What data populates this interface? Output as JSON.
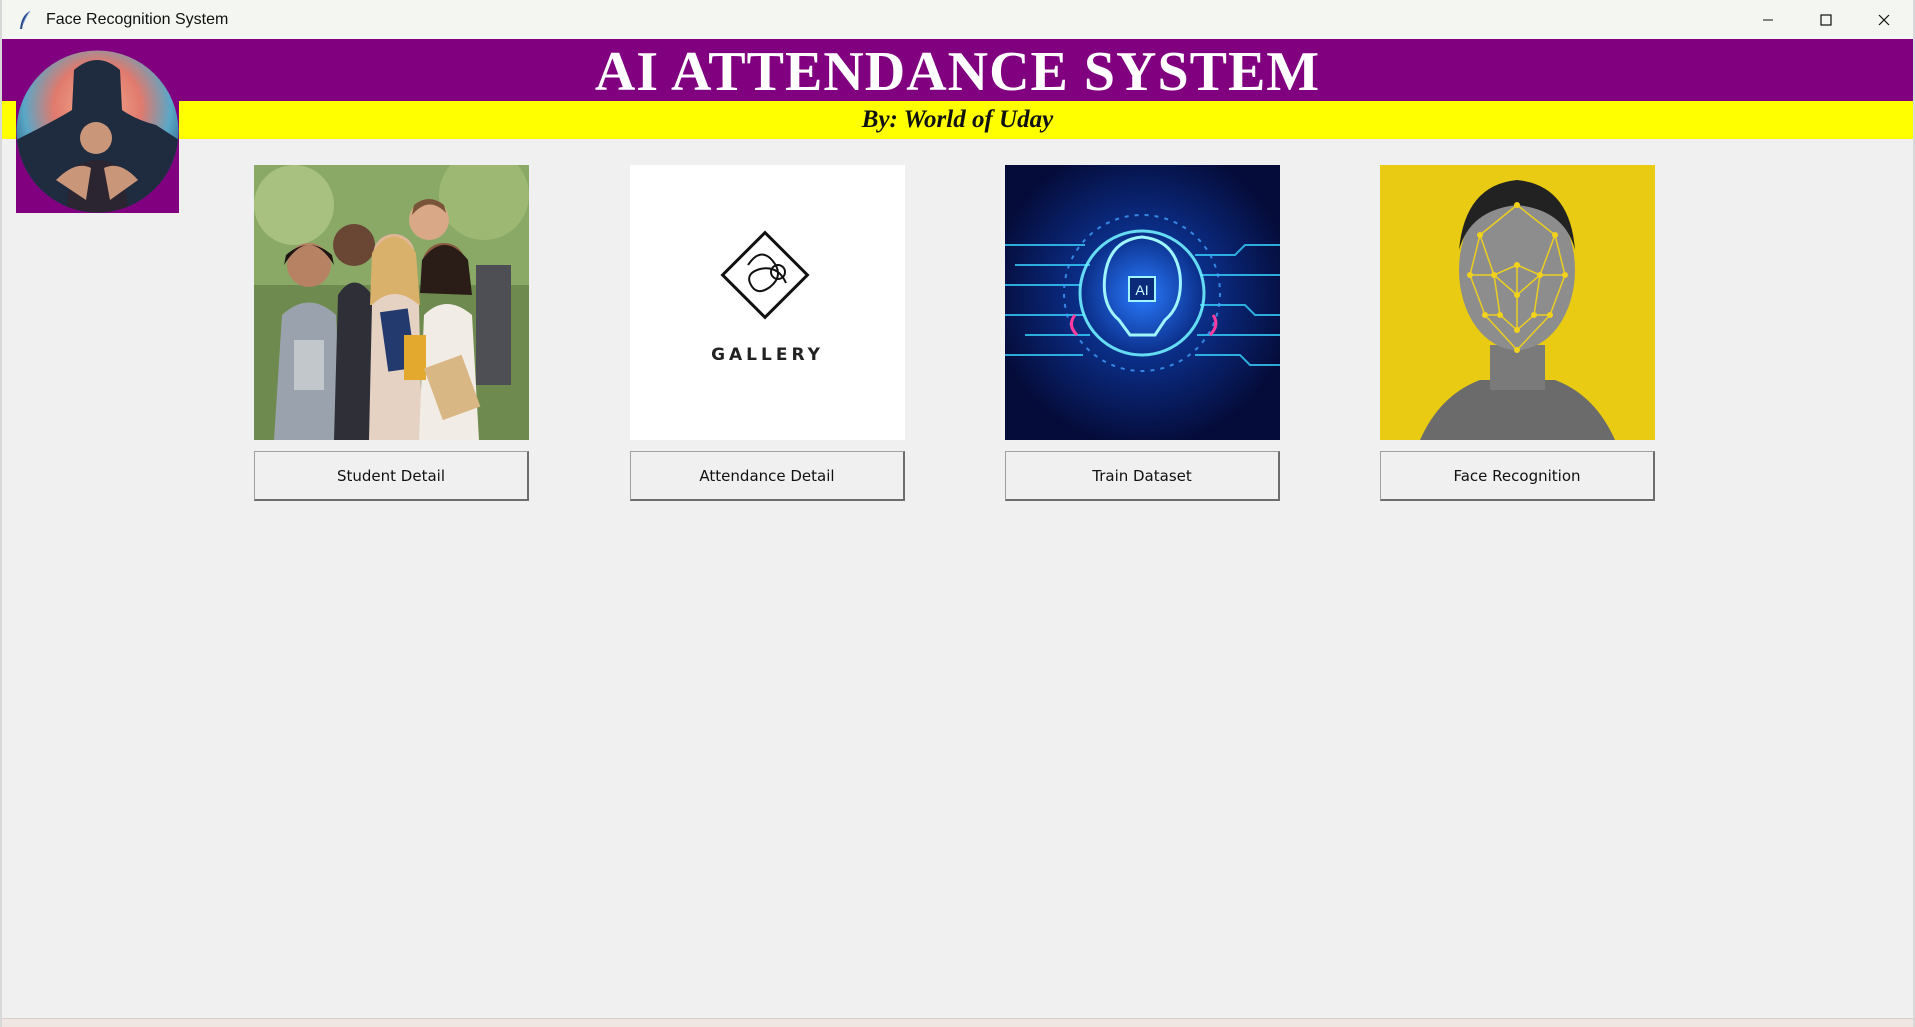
{
  "window": {
    "title": "Face Recognition System",
    "icon": "feather-icon",
    "controls": [
      "minimize-icon",
      "maximize-icon",
      "close-icon"
    ]
  },
  "header": {
    "title": "AI ATTENDANCE SYSTEM",
    "subtitle": "By: World of Uday",
    "title_bg": "#800080",
    "subtitle_bg": "#ffff00"
  },
  "logo": {
    "description_icon": "profile-avatar-icon"
  },
  "cards": [
    {
      "label": "Student Detail",
      "image": "students-photo"
    },
    {
      "label": "Attendance Detail",
      "image": "gallery-logo",
      "image_text": "GALLERY"
    },
    {
      "label": "Train Dataset",
      "image": "ai-brain-circuit"
    },
    {
      "label": "Face Recognition",
      "image": "face-mesh-photo"
    }
  ]
}
